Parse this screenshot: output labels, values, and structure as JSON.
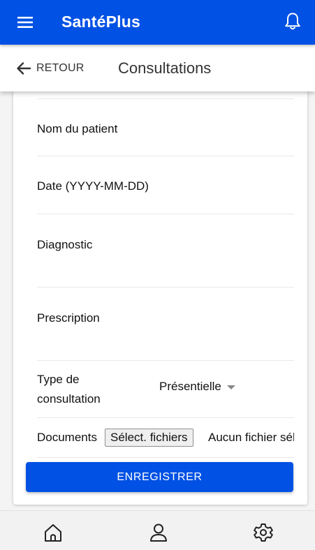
{
  "app": {
    "title": "SantéPlus",
    "brand_color": "#0051e4"
  },
  "icons": {
    "menu": "hamburger-menu-icon",
    "notifications": "bell-icon",
    "back": "arrow-left-icon",
    "home": "home-icon",
    "profile": "user-icon",
    "settings": "gear-icon"
  },
  "header": {
    "back_label": "RETOUR",
    "page_title": "Consultations"
  },
  "form": {
    "fields": {
      "patient_name": {
        "label": "Nom du patient",
        "value": ""
      },
      "date": {
        "label": "Date (YYYY-MM-DD)",
        "value": ""
      },
      "diagnostic": {
        "label": "Diagnostic",
        "value": ""
      },
      "prescription": {
        "label": "Prescription",
        "value": ""
      },
      "consultation_type": {
        "label_line1": "Type de",
        "label_line2": "consultation",
        "selected": "Présentielle"
      },
      "documents": {
        "label": "Documents",
        "button_label": "Sélect. fichiers",
        "status": "Aucun fichier sélectionné"
      }
    },
    "submit_label": "ENREGISTRER"
  }
}
